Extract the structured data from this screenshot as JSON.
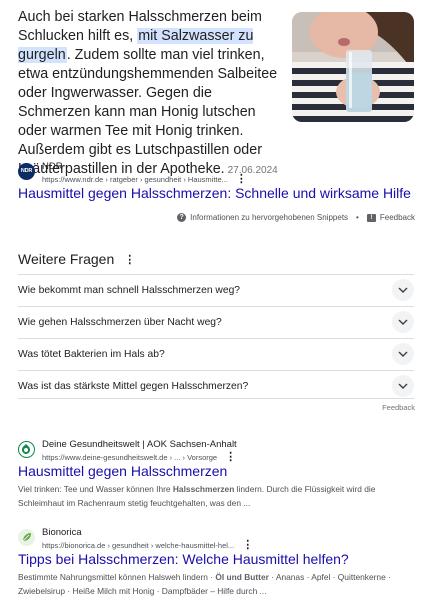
{
  "featured_snippet": {
    "text_before": "Auch bei starken Halsschmerzen beim Schlucken hilft es, ",
    "highlight": "mit Salzwasser zu gurgeln",
    "text_after": ". Zudem sollte man viel trinken, etwa entzündungshemmenden Salbeitee oder Ingwerwasser. Gegen die Schmerzen kann man Honig lutschen oder warmen Tee mit Honig trinken. Außerdem gibt es Lutschpastillen oder Kräuterpastillen in der Apotheke.",
    "date": "27.06.2024",
    "source": {
      "favicon_text": "NDR",
      "name": "NDR",
      "url": "https://www.ndr.de › ratgeber › gesundheit › Hausmitte...",
      "menu": "⋮"
    },
    "link_title": "Hausmittel gegen Halsschmerzen: Schnelle und wirksame Hilfe",
    "info_label": "Informationen zu hervorgehobenen Snippets",
    "info_separator": "•",
    "feedback_label": "Feedback"
  },
  "people_also_ask": {
    "title": "Weitere Fragen",
    "menu": "⋮",
    "questions": [
      "Wie bekommt man schnell Halsschmerzen weg?",
      "Wie gehen Halsschmerzen über Nacht weg?",
      "Was tötet Bakterien im Hals ab?",
      "Was ist das stärkste Mittel gegen Halsschmerzen?"
    ],
    "feedback_label": "Feedback"
  },
  "results": [
    {
      "source_name": "Deine Gesundheitswelt | AOK Sachsen-Anhalt",
      "url": "https://www.deine-gesundheitswelt.de › ... › Vorsorge",
      "menu": "⋮",
      "title": "Hausmittel gegen Halsschmerzen",
      "desc_1": "Viel trinken: Tee und Wasser können Ihre ",
      "desc_bold": "Halsschmerzen",
      "desc_2": " lindern. Durch die Flüssigkeit wird die Schleimhaut im Rachenraum stetig feuchtgehalten, was den ..."
    },
    {
      "source_name": "Bionorica",
      "url": "https://bionorica.de › gesundheit › welche-hausmittel-hel...",
      "menu": "⋮",
      "title": "Tipps bei Halsschmerzen: Welche Hausmittel helfen?",
      "desc_1": "Bestimmte Nahrungsmittel können Halsweh lindern · ",
      "desc_bold": "Öl und Butter",
      "desc_2": " · Ananas · Apfel · Quittenkerne · Zwiebelsirup · Heiße Milch mit Honig · Dampfbäder – Hilfe durch ..."
    }
  ],
  "colors": {
    "link": "#1a0dab",
    "highlight": "#d3e3fd",
    "ndr": "#0c2d64",
    "aok": "#108a48"
  }
}
